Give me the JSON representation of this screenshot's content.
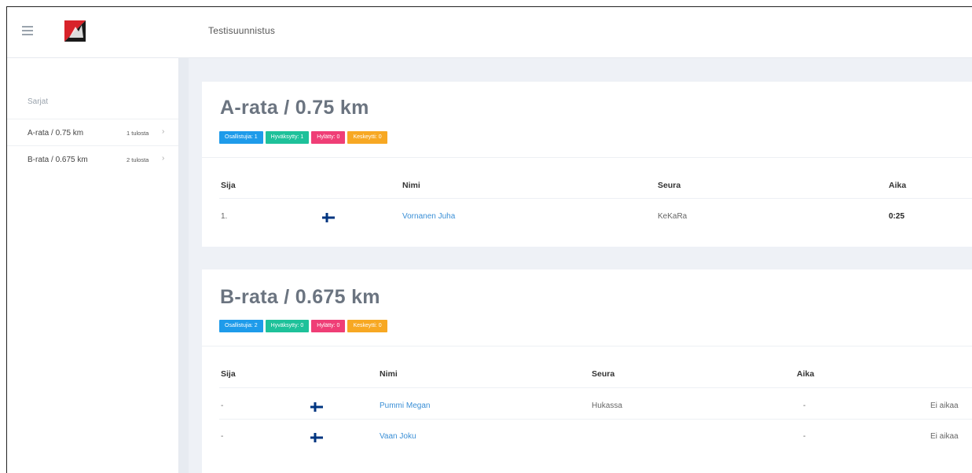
{
  "header": {
    "menu_icon": "hamburger-icon",
    "logo": "app-logo",
    "title": "Testisuunnistus"
  },
  "sidebar": {
    "heading": "Sarjat",
    "items": [
      {
        "label": "A-rata / 0.75 km",
        "count": "1 tulosta"
      },
      {
        "label": "B-rata / 0.675 km",
        "count": "2 tulosta"
      }
    ]
  },
  "courses": [
    {
      "title": "A-rata / 0.75 km",
      "badges": [
        "Osallistujia: 1",
        "Hyväksytty: 1",
        "Hylätty: 0",
        "Keskeytti: 0"
      ],
      "columns": [
        "Sija",
        "Nimi",
        "Seura",
        "Aika"
      ],
      "rows": [
        {
          "position": "1.",
          "name": "Vornanen Juha",
          "club": "KeKaRa",
          "time": "0:25",
          "note": ""
        }
      ]
    },
    {
      "title": "B-rata / 0.675 km",
      "badges": [
        "Osallistujia: 2",
        "Hyväksytty: 0",
        "Hylätty: 0",
        "Keskeytti: 0"
      ],
      "columns": [
        "Sija",
        "Nimi",
        "Seura",
        "Aika"
      ],
      "rows": [
        {
          "position": "-",
          "name": "Pummi Megan",
          "club": "Hukassa",
          "time": "-",
          "note": "Ei aikaa"
        },
        {
          "position": "-",
          "name": "Vaan Joku",
          "club": "",
          "time": "-",
          "note": "Ei aikaa"
        }
      ]
    }
  ],
  "colors": {
    "badge_participants": "#1e9bea",
    "badge_approved": "#1ec19a",
    "badge_rejected": "#ef3e76",
    "badge_aborted": "#f7a823",
    "link": "#3a8fd6"
  }
}
